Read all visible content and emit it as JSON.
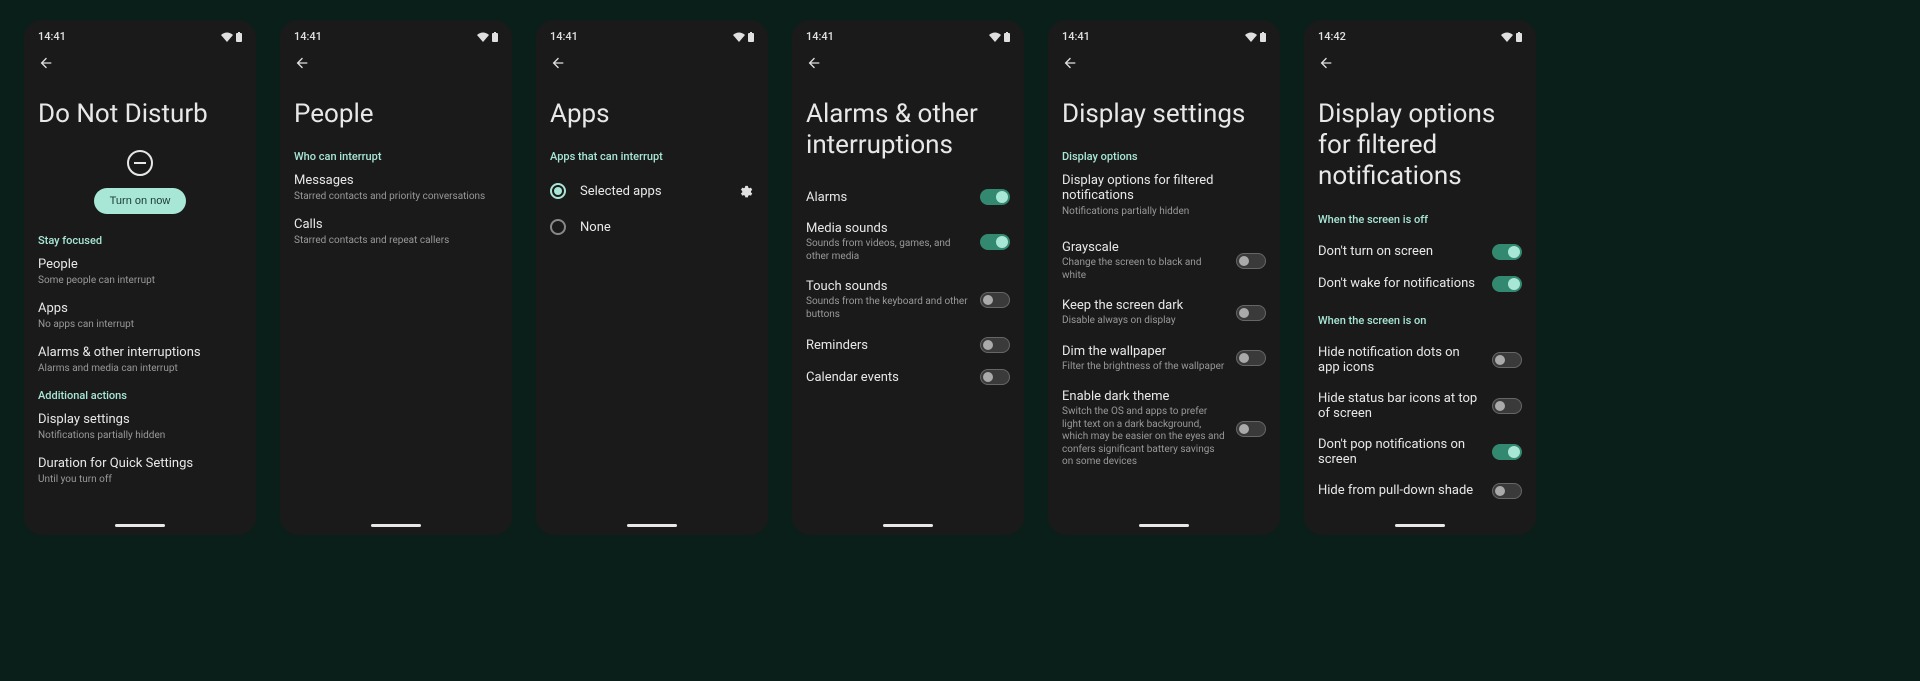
{
  "status": {
    "time1": "14:41",
    "time2": "14:42"
  },
  "screen1": {
    "title": "Do Not Disturb",
    "turn_on": "Turn on now",
    "section_stay": "Stay focused",
    "people": {
      "title": "People",
      "sub": "Some people can interrupt"
    },
    "apps": {
      "title": "Apps",
      "sub": "No apps can interrupt"
    },
    "alarms": {
      "title": "Alarms & other interruptions",
      "sub": "Alarms and media can interrupt"
    },
    "section_add": "Additional actions",
    "display": {
      "title": "Display settings",
      "sub": "Notifications partially hidden"
    },
    "duration": {
      "title": "Duration for Quick Settings",
      "sub": "Until you turn off"
    }
  },
  "screen2": {
    "title": "People",
    "section": "Who can interrupt",
    "messages": {
      "title": "Messages",
      "sub": "Starred contacts and priority conversations"
    },
    "calls": {
      "title": "Calls",
      "sub": "Starred contacts and repeat callers"
    }
  },
  "screen3": {
    "title": "Apps",
    "section": "Apps that can interrupt",
    "selected": "Selected apps",
    "none": "None"
  },
  "screen4": {
    "title": "Alarms & other interruptions",
    "alarms": "Alarms",
    "media": {
      "title": "Media sounds",
      "sub": "Sounds from videos, games, and other media"
    },
    "touch": {
      "title": "Touch sounds",
      "sub": "Sounds from the keyboard and other buttons"
    },
    "reminders": "Reminders",
    "calendar": "Calendar events"
  },
  "screen5": {
    "title": "Display settings",
    "section": "Display options",
    "filtered": {
      "title": "Display options for filtered notifications",
      "sub": "Notifications partially hidden"
    },
    "grayscale": {
      "title": "Grayscale",
      "sub": "Change the screen to black and white"
    },
    "keep_dark": {
      "title": "Keep the screen dark",
      "sub": "Disable always on display"
    },
    "dim": {
      "title": "Dim the wallpaper",
      "sub": "Filter the brightness of the wallpaper"
    },
    "dark_theme": {
      "title": "Enable dark theme",
      "sub": "Switch the OS and apps to prefer light text on a dark background, which may be easier on the eyes and confers significant battery savings on some devices"
    }
  },
  "screen6": {
    "title": "Display options for filtered notifications",
    "section_off": "When the screen is off",
    "dont_turn": "Don't turn on screen",
    "dont_wake": "Don't wake for notifications",
    "section_on": "When the screen is on",
    "hide_dots": "Hide notification dots on app icons",
    "hide_status": "Hide status bar icons at top of screen",
    "dont_pop": "Don't pop notifications on screen",
    "hide_shade": "Hide from pull-down shade"
  }
}
